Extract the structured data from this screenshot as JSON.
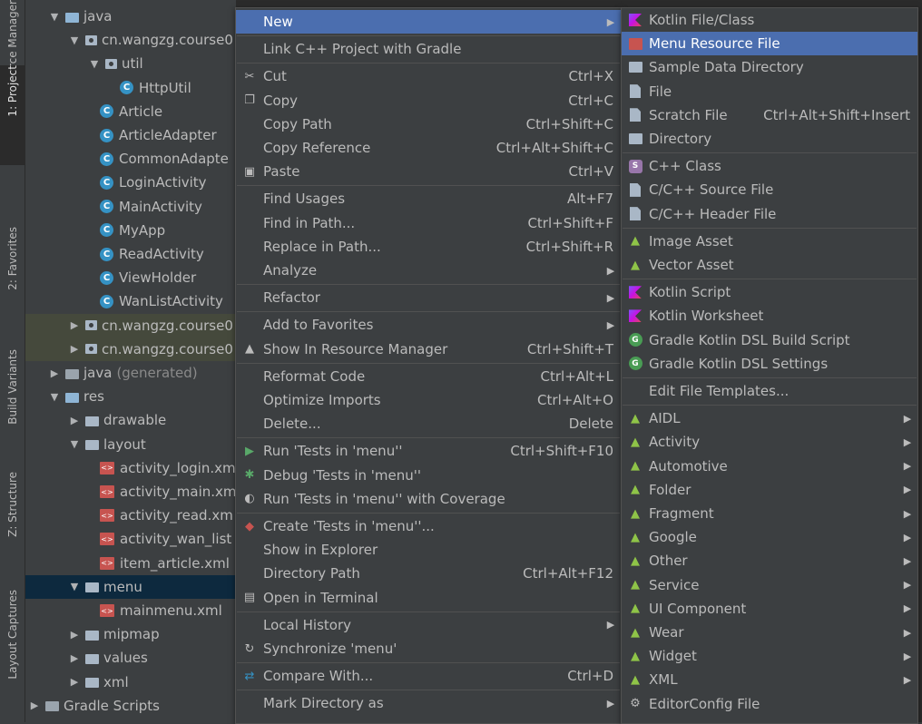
{
  "left_strip": {
    "tabs": [
      "Resource Manager",
      "1: Project",
      "2: Favorites",
      "Build Variants",
      "Z: Structure",
      "Layout Captures"
    ]
  },
  "tree": {
    "rows": [
      {
        "label": "java",
        "kind": "folder",
        "indent": 1,
        "arrow": "down"
      },
      {
        "label": "cn.wangzg.course0",
        "kind": "package",
        "indent": 2,
        "arrow": "down"
      },
      {
        "label": "util",
        "kind": "package",
        "indent": 3,
        "arrow": "down"
      },
      {
        "label": "HttpUtil",
        "kind": "class",
        "indent": 4
      },
      {
        "label": "Article",
        "kind": "class",
        "indent": 3
      },
      {
        "label": "ArticleAdapter",
        "kind": "class",
        "indent": 3
      },
      {
        "label": "CommonAdapte",
        "kind": "class",
        "indent": 3
      },
      {
        "label": "LoginActivity",
        "kind": "class",
        "indent": 3
      },
      {
        "label": "MainActivity",
        "kind": "class",
        "indent": 3
      },
      {
        "label": "MyApp",
        "kind": "class",
        "indent": 3
      },
      {
        "label": "ReadActivity",
        "kind": "class",
        "indent": 3
      },
      {
        "label": "ViewHolder",
        "kind": "class",
        "indent": 3
      },
      {
        "label": "WanListActivity",
        "kind": "class",
        "indent": 3
      },
      {
        "label": "cn.wangzg.course0",
        "kind": "package",
        "indent": 2,
        "arrow": "right",
        "state": "hl"
      },
      {
        "label": "cn.wangzg.course0",
        "kind": "package",
        "indent": 2,
        "arrow": "right",
        "state": "hl"
      },
      {
        "label": "java",
        "suffix": "(generated)",
        "kind": "folder-gen",
        "indent": 1,
        "arrow": "right"
      },
      {
        "label": "res",
        "kind": "folder",
        "indent": 1,
        "arrow": "down"
      },
      {
        "label": "drawable",
        "kind": "folder-dk",
        "indent": 2,
        "arrow": "right"
      },
      {
        "label": "layout",
        "kind": "folder-dk",
        "indent": 2,
        "arrow": "down"
      },
      {
        "label": "activity_login.xm",
        "kind": "xml",
        "indent": 3
      },
      {
        "label": "activity_main.xm",
        "kind": "xml",
        "indent": 3
      },
      {
        "label": "activity_read.xm",
        "kind": "xml",
        "indent": 3
      },
      {
        "label": "activity_wan_list",
        "kind": "xml",
        "indent": 3
      },
      {
        "label": "item_article.xml",
        "kind": "xml",
        "indent": 3
      },
      {
        "label": "menu",
        "kind": "folder-dk",
        "indent": 2,
        "arrow": "down",
        "state": "sel"
      },
      {
        "label": "mainmenu.xml",
        "kind": "xml",
        "indent": 3
      },
      {
        "label": "mipmap",
        "kind": "folder-dk",
        "indent": 2,
        "arrow": "right"
      },
      {
        "label": "values",
        "kind": "folder-dk",
        "indent": 2,
        "arrow": "right"
      },
      {
        "label": "xml",
        "kind": "folder-dk",
        "indent": 2,
        "arrow": "right"
      },
      {
        "label": "Gradle Scripts",
        "kind": "gradle",
        "indent": 0,
        "arrow": "right"
      }
    ]
  },
  "context_menu": {
    "items": [
      {
        "label": "New",
        "shortcut": "",
        "icon": "",
        "submenu": true,
        "active": true
      },
      {
        "sep": true
      },
      {
        "label": "Link C++ Project with Gradle",
        "shortcut": ""
      },
      {
        "sep": true
      },
      {
        "label": "Cut",
        "shortcut": "Ctrl+X",
        "icon": "scissors-icon"
      },
      {
        "label": "Copy",
        "shortcut": "Ctrl+C",
        "icon": "copy-icon"
      },
      {
        "label": "Copy Path",
        "shortcut": "Ctrl+Shift+C"
      },
      {
        "label": "Copy Reference",
        "shortcut": "Ctrl+Alt+Shift+C"
      },
      {
        "label": "Paste",
        "shortcut": "Ctrl+V",
        "icon": "paste-icon"
      },
      {
        "sep": true
      },
      {
        "label": "Find Usages",
        "shortcut": "Alt+F7"
      },
      {
        "label": "Find in Path...",
        "shortcut": "Ctrl+Shift+F"
      },
      {
        "label": "Replace in Path...",
        "shortcut": "Ctrl+Shift+R"
      },
      {
        "label": "Analyze",
        "shortcut": "",
        "submenu": true
      },
      {
        "sep": true
      },
      {
        "label": "Refactor",
        "shortcut": "",
        "submenu": true
      },
      {
        "sep": true
      },
      {
        "label": "Add to Favorites",
        "shortcut": "",
        "submenu": true
      },
      {
        "label": "Show In Resource Manager",
        "shortcut": "Ctrl+Shift+T",
        "icon": "resource-manager-icon"
      },
      {
        "sep": true
      },
      {
        "label": "Reformat Code",
        "shortcut": "Ctrl+Alt+L"
      },
      {
        "label": "Optimize Imports",
        "shortcut": "Ctrl+Alt+O"
      },
      {
        "label": "Delete...",
        "shortcut": "Delete"
      },
      {
        "sep": true
      },
      {
        "label": "Run 'Tests in 'menu''",
        "shortcut": "Ctrl+Shift+F10",
        "icon": "run-icon"
      },
      {
        "label": "Debug 'Tests in 'menu''",
        "shortcut": "",
        "icon": "debug-icon"
      },
      {
        "label": "Run 'Tests in 'menu'' with Coverage",
        "shortcut": "",
        "icon": "coverage-icon"
      },
      {
        "sep": true
      },
      {
        "label": "Create 'Tests in 'menu''...",
        "shortcut": "",
        "icon": "create-test-icon"
      },
      {
        "label": "Show in Explorer",
        "shortcut": ""
      },
      {
        "label": "Directory Path",
        "shortcut": "Ctrl+Alt+F12"
      },
      {
        "label": "Open in Terminal",
        "shortcut": "",
        "icon": "terminal-icon"
      },
      {
        "sep": true
      },
      {
        "label": "Local History",
        "shortcut": "",
        "submenu": true
      },
      {
        "label": "Synchronize 'menu'",
        "shortcut": "",
        "icon": "sync-icon"
      },
      {
        "sep": true
      },
      {
        "label": "Compare With...",
        "shortcut": "Ctrl+D",
        "icon": "compare-icon"
      },
      {
        "sep": true
      },
      {
        "label": "Mark Directory as",
        "shortcut": "",
        "submenu": true
      }
    ]
  },
  "new_submenu": {
    "items": [
      {
        "label": "Kotlin File/Class",
        "shortcut": "",
        "icon": "kotlin"
      },
      {
        "label": "Menu Resource File",
        "shortcut": "",
        "icon": "resource",
        "active": true
      },
      {
        "label": "Sample Data Directory",
        "shortcut": "",
        "icon": "dir"
      },
      {
        "label": "File",
        "shortcut": "",
        "icon": "file"
      },
      {
        "label": "Scratch File",
        "shortcut": "Ctrl+Alt+Shift+Insert",
        "icon": "file"
      },
      {
        "label": "Directory",
        "shortcut": "",
        "icon": "dir"
      },
      {
        "sep": true
      },
      {
        "label": "C++ Class",
        "shortcut": "",
        "icon": "s"
      },
      {
        "label": "C/C++ Source File",
        "shortcut": "",
        "icon": "file"
      },
      {
        "label": "C/C++ Header File",
        "shortcut": "",
        "icon": "file"
      },
      {
        "sep": true
      },
      {
        "label": "Image Asset",
        "shortcut": "",
        "icon": "android"
      },
      {
        "label": "Vector Asset",
        "shortcut": "",
        "icon": "android"
      },
      {
        "sep": true
      },
      {
        "label": "Kotlin Script",
        "shortcut": "",
        "icon": "kotlin"
      },
      {
        "label": "Kotlin Worksheet",
        "shortcut": "",
        "icon": "kotlin"
      },
      {
        "label": "Gradle Kotlin DSL Build Script",
        "shortcut": "",
        "icon": "gradle"
      },
      {
        "label": "Gradle Kotlin DSL Settings",
        "shortcut": "",
        "icon": "gradle"
      },
      {
        "sep": true
      },
      {
        "label": "Edit File Templates...",
        "shortcut": "",
        "icon": ""
      },
      {
        "sep": true
      },
      {
        "label": "AIDL",
        "shortcut": "",
        "icon": "android",
        "submenu": true
      },
      {
        "label": "Activity",
        "shortcut": "",
        "icon": "android",
        "submenu": true
      },
      {
        "label": "Automotive",
        "shortcut": "",
        "icon": "android",
        "submenu": true
      },
      {
        "label": "Folder",
        "shortcut": "",
        "icon": "android",
        "submenu": true
      },
      {
        "label": "Fragment",
        "shortcut": "",
        "icon": "android",
        "submenu": true
      },
      {
        "label": "Google",
        "shortcut": "",
        "icon": "android",
        "submenu": true
      },
      {
        "label": "Other",
        "shortcut": "",
        "icon": "android",
        "submenu": true
      },
      {
        "label": "Service",
        "shortcut": "",
        "icon": "android",
        "submenu": true
      },
      {
        "label": "UI Component",
        "shortcut": "",
        "icon": "android",
        "submenu": true
      },
      {
        "label": "Wear",
        "shortcut": "",
        "icon": "android",
        "submenu": true
      },
      {
        "label": "Widget",
        "shortcut": "",
        "icon": "android",
        "submenu": true
      },
      {
        "label": "XML",
        "shortcut": "",
        "icon": "android",
        "submenu": true
      },
      {
        "label": "EditorConfig File",
        "shortcut": "",
        "icon": "gear"
      }
    ]
  }
}
